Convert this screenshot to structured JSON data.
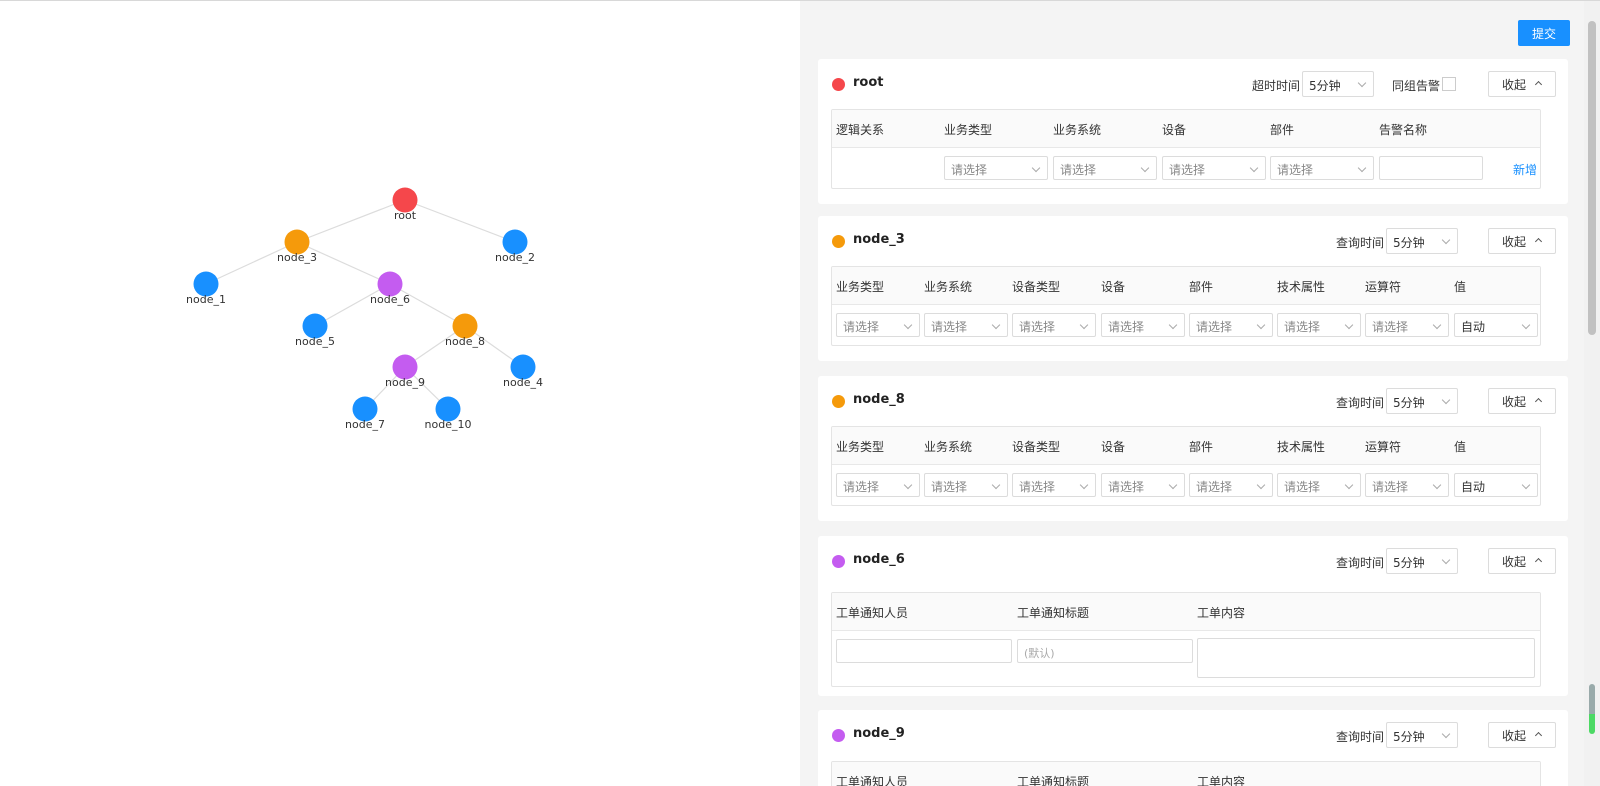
{
  "colors": {
    "red": "#f5474b",
    "orange": "#f59a0b",
    "blue": "#1890ff",
    "purple": "#c45cf0",
    "primary": "#1890ff"
  },
  "toolbar": {
    "submit_label": "提交"
  },
  "tree": {
    "nodes": [
      {
        "id": "root",
        "label": "root",
        "color": "red"
      },
      {
        "id": "node_3",
        "label": "node_3",
        "color": "orange"
      },
      {
        "id": "node_2",
        "label": "node_2",
        "color": "blue"
      },
      {
        "id": "node_1",
        "label": "node_1",
        "color": "blue"
      },
      {
        "id": "node_6",
        "label": "node_6",
        "color": "purple"
      },
      {
        "id": "node_5",
        "label": "node_5",
        "color": "blue"
      },
      {
        "id": "node_8",
        "label": "node_8",
        "color": "orange"
      },
      {
        "id": "node_9",
        "label": "node_9",
        "color": "purple"
      },
      {
        "id": "node_4",
        "label": "node_4",
        "color": "blue"
      },
      {
        "id": "node_7",
        "label": "node_7",
        "color": "blue"
      },
      {
        "id": "node_10",
        "label": "node_10",
        "color": "blue"
      }
    ],
    "edges": [
      [
        "root",
        "node_3"
      ],
      [
        "root",
        "node_2"
      ],
      [
        "node_3",
        "node_1"
      ],
      [
        "node_3",
        "node_6"
      ],
      [
        "node_6",
        "node_5"
      ],
      [
        "node_6",
        "node_8"
      ],
      [
        "node_8",
        "node_9"
      ],
      [
        "node_8",
        "node_4"
      ],
      [
        "node_9",
        "node_7"
      ],
      [
        "node_9",
        "node_10"
      ]
    ]
  },
  "cards": {
    "root": {
      "title": "root",
      "timeout_label": "超时时间",
      "timeout_value": "5分钟",
      "same_group_label": "同组告警",
      "collapse_label": "收起",
      "headers": [
        "逻辑关系",
        "业务类型",
        "业务系统",
        "设备",
        "部件",
        "告警名称"
      ],
      "placeholder": "请选择",
      "add_label": "新增"
    },
    "node_3": {
      "title": "node_3",
      "query_label": "查询时间",
      "query_value": "5分钟",
      "collapse_label": "收起",
      "headers": [
        "业务类型",
        "业务系统",
        "设备类型",
        "设备",
        "部件",
        "技术属性",
        "运算符",
        "值"
      ],
      "placeholder": "请选择",
      "value": "自动"
    },
    "node_8": {
      "title": "node_8",
      "query_label": "查询时间",
      "query_value": "5分钟",
      "collapse_label": "收起",
      "headers": [
        "业务类型",
        "业务系统",
        "设备类型",
        "设备",
        "部件",
        "技术属性",
        "运算符",
        "值"
      ],
      "placeholder": "请选择",
      "value": "自动"
    },
    "node_6": {
      "title": "node_6",
      "query_label": "查询时间",
      "query_value": "5分钟",
      "collapse_label": "收起",
      "headers": [
        "工单通知人员",
        "工单通知标题",
        "工单内容"
      ],
      "title_placeholder": "(默认)"
    },
    "node_9": {
      "title": "node_9",
      "query_label": "查询时间",
      "query_value": "5分钟",
      "collapse_label": "收起",
      "headers": [
        "工单通知人员",
        "工单通知标题",
        "工单内容"
      ]
    }
  }
}
